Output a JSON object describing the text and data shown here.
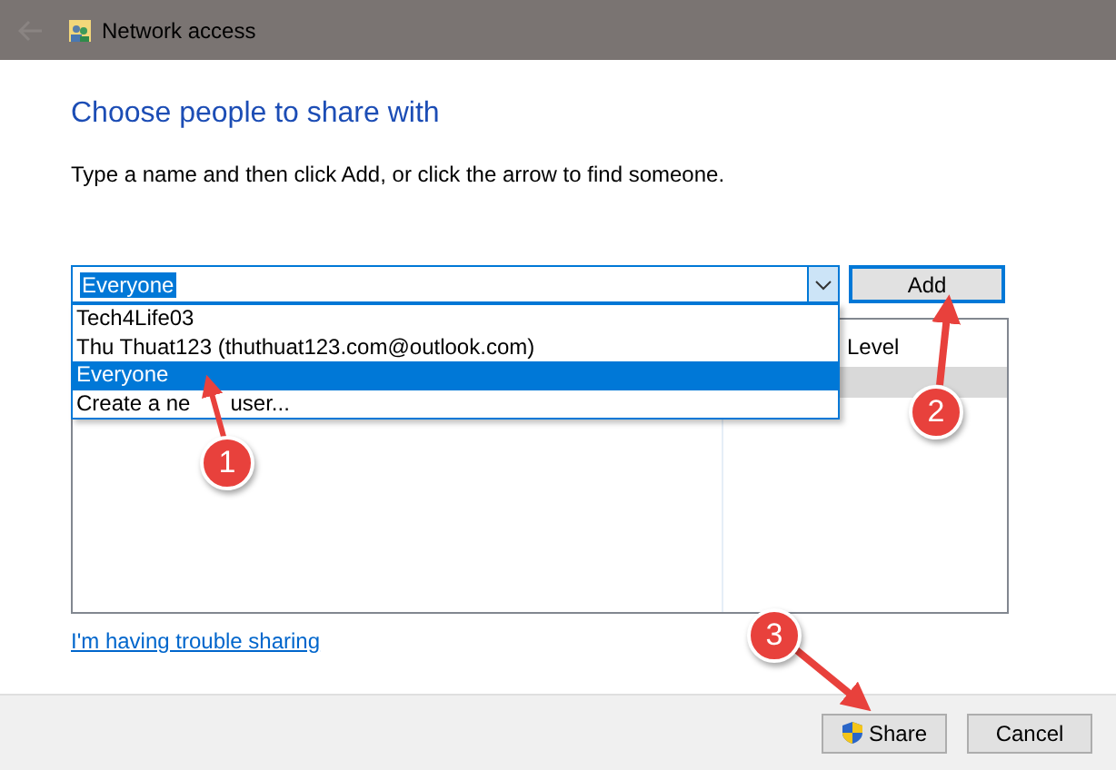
{
  "window": {
    "title": "Network access"
  },
  "heading": "Choose people to share with",
  "instruction": "Type a name and then click Add, or click the arrow to find someone.",
  "name_combo": {
    "value": "Everyone",
    "value_highlighted": true,
    "expanded": true,
    "options": [
      {
        "label": "Tech4Life03",
        "selected": false
      },
      {
        "label": "Thu Thuat123 (thuthuat123.com@outlook.com)",
        "selected": false
      },
      {
        "label": "Everyone",
        "selected": true
      },
      {
        "label": "Create a ne",
        "label_after_arrow": "user...",
        "selected": false
      }
    ]
  },
  "add_button": "Add",
  "share_list": {
    "column_2": "Level",
    "rows": [
      {
        "selected": true
      }
    ]
  },
  "help_link": "I'm having trouble sharing",
  "buttons": [
    {
      "label": "Share",
      "kind": "shield"
    },
    {
      "label": "Cancel",
      "kind": "plain"
    }
  ],
  "annotations": [
    {
      "number": "1"
    },
    {
      "number": "2"
    },
    {
      "number": "3"
    }
  ]
}
